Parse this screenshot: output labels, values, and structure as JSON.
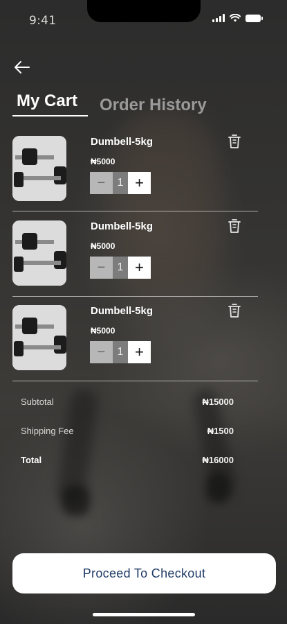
{
  "status_bar": {
    "time": "9:41"
  },
  "tabs": [
    {
      "label": "My Cart",
      "active": true
    },
    {
      "label": "Order History",
      "active": false
    }
  ],
  "cart": {
    "items": [
      {
        "name": "Dumbell-5kg",
        "price": "₦5000",
        "quantity": "1",
        "minus": "−",
        "plus": "+"
      },
      {
        "name": "Dumbell-5kg",
        "price": "₦5000",
        "quantity": "1",
        "minus": "−",
        "plus": "+"
      },
      {
        "name": "Dumbell-5kg",
        "price": "₦5000",
        "quantity": "1",
        "minus": "−",
        "plus": "+"
      }
    ]
  },
  "summary": {
    "subtotal_label": "Subtotal",
    "subtotal_value": "₦15000",
    "shipping_label": "Shipping Fee",
    "shipping_value": "₦1500",
    "total_label": "Total",
    "total_value": "₦16000"
  },
  "checkout": {
    "label": "Proceed To Checkout"
  },
  "colors": {
    "checkout_text": "#1f3a66",
    "stepper_minus_bg": "#b7b7b7",
    "stepper_qty_bg": "#7c7c7c"
  },
  "icons": [
    "back-arrow-icon",
    "trash-icon",
    "signal-icon",
    "wifi-icon",
    "battery-icon"
  ]
}
